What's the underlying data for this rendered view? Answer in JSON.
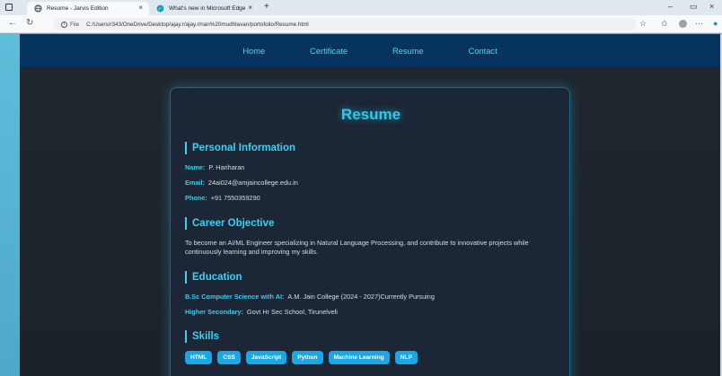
{
  "browser": {
    "tabs": [
      {
        "title": "Resume - Jarvis Edition",
        "active": true
      },
      {
        "title": "What's new in Microsoft Edge",
        "active": false
      }
    ],
    "new_tab_symbol": "+",
    "url_prefix": "File",
    "url": "C:/Users/r343/OneDrive/Desktop/ajay.r/ajay.r/nan%20mudhlavan/portofolio/Resume.html"
  },
  "nav": {
    "items": [
      "Home",
      "Certificate",
      "Resume",
      "Contact"
    ]
  },
  "resume": {
    "title": "Resume",
    "personal": {
      "heading": "Personal Information",
      "name_label": "Name:",
      "name": "P. Hariharan",
      "email_label": "Email:",
      "email": "24ai024@amjaincollege.edu.in",
      "phone_label": "Phone:",
      "phone": "+91 7550359290"
    },
    "career": {
      "heading": "Career Objective",
      "text": "To become an AI/ML Engineer specializing in Natural Language Processing, and contribute to innovative projects while continuously learning and improving my skills."
    },
    "education": {
      "heading": "Education",
      "items": [
        {
          "label": "B.Sc Computer Science with AI:",
          "value": "A.M. Jain College (2024 - 2027)Currently Pursuing"
        },
        {
          "label": "Higher Secondary:",
          "value": "Govt Hr Sec School, Tirunelveli"
        }
      ]
    },
    "skills": {
      "heading": "Skills",
      "items": [
        "HTML",
        "CSS",
        "JavaScript",
        "Python",
        "Machine Learning",
        "NLP"
      ]
    }
  },
  "colors": {
    "nav_bg": "#07345e",
    "accent": "#33c7e8",
    "chip": "#1aa7e6",
    "page_bg": "#20262e",
    "card_bg": "#1b2636"
  }
}
